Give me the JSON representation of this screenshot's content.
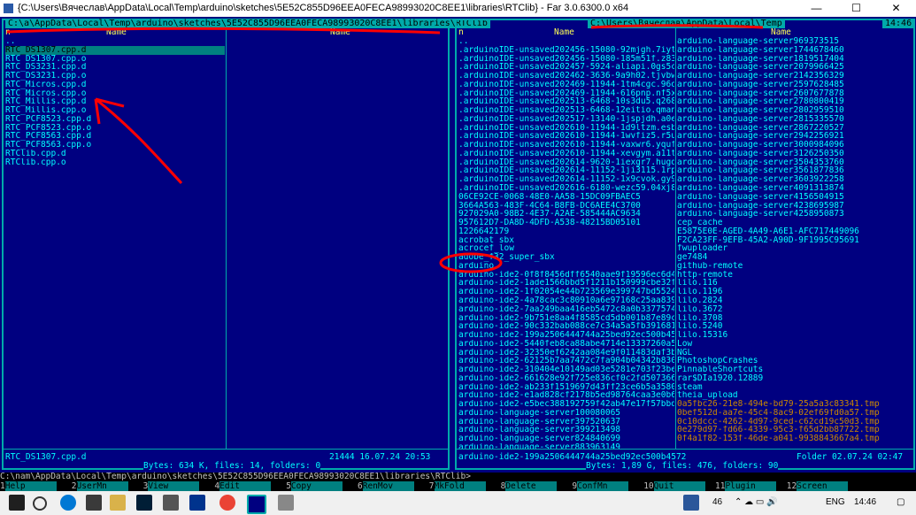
{
  "window": {
    "title": "{C:\\Users\\Вячеслав\\AppData\\Local\\Temp\\arduino\\sketches\\5E52C855D96EEA0FECA98993020C8EE1\\libraries\\RTClib} - Far 3.0.6300.0 x64",
    "min": "—",
    "max": "☐",
    "close": "✕"
  },
  "clock": "14:46",
  "left_panel": {
    "path": " C:\\a\\AppData\\Local\\Temp\\arduino\\sketches\\5E52C855D96EEA0FECA98993020C8EE1\\libraries\\RTClib ",
    "col1_header": "Name",
    "col2_header": "Name",
    "sort": "n",
    "files": [
      "..",
      "RTC_DS1307.cpp.d",
      "RTC_DS1307.cpp.o",
      "RTC_DS3231.cpp.d",
      "RTC_DS3231.cpp.o",
      "RTC_Micros.cpp.d",
      "RTC_Micros.cpp.o",
      "RTC_Millis.cpp.d",
      "RTC_Millis.cpp.o",
      "RTC_PCF8523.cpp.d",
      "RTC_PCF8523.cpp.o",
      "RTC_PCF8563.cpp.d",
      "RTC_PCF8563.cpp.o",
      "RTClib.cpp.d",
      "RTClib.cpp.o"
    ],
    "current_file": "RTC_DS1307.cpp.d",
    "file_info": "21444 16.07.24 20:53",
    "summary": " Bytes: 634 K, files: 14, folders: 0 "
  },
  "right_panel": {
    "path": " C:\\Users\\Вячеслав\\AppData\\Local\\Temp ",
    "col1_header": "Name",
    "col2_header": "Name",
    "sort": "n",
    "col1": [
      "..",
      ".arduinoIDE-unsaved202456-15080-92mjgh.7iytp",
      ".arduinoIDE-unsaved202456-15080-185m51f.z83d",
      ".arduinoIDE-unsaved202457-5924-aliapi.0gs5c",
      ".arduinoIDE-unsaved202462-3636-9a9h02.tjvbw",
      ".arduinoIDE-unsaved202469-11944-1tm4cgc.96oi",
      ".arduinoIDE-unsaved202469-11944-616pnp.nf5xa",
      ".arduinoIDE-unsaved202513-6468-10s3du5.q268",
      ".arduinoIDE-unsaved202513-6468-12eitio.qman",
      ".arduinoIDE-unsaved202517-13140-1jspjdh.a0es",
      ".arduinoIDE-unsaved202610-11944-1d9ltzm.esbj",
      ".arduinoIDE-unsaved202610-11944-1wvfiz5.r5ui",
      ".arduinoIDE-unsaved202610-11944-vaxwr6.yqufl",
      ".arduinoIDE-unsaved202610-11944-xevgym.a11t",
      ".arduinoIDE-unsaved202614-9620-1iexgr7.hugd",
      ".arduinoIDE-unsaved202614-11152-1ji3115.1rph",
      ".arduinoIDE-unsaved202614-11152-1x9cvok.gy92",
      ".arduinoIDE-unsaved202616-6180-wezc59.04xj8",
      "06CE92CE-0068-48E0-AA58-15DC09FBAEC5",
      "3664A563-483F-4C64-B8FB-DC6AEE4C3700",
      "927029A0-98B2-4E37-A2AE-585444AC9634",
      "957612D7-DA8D-4DFD-A538-48215BD05101",
      "1226642179",
      "acrobat_sbx",
      "acrocef_low",
      "adobe_f32_super_sbx",
      "arduino",
      "arduino-ide2-0f8f8456dff6540aae9f19596ec6d42b",
      "arduino-ide2-1ade1566bbd5f1211b150999cbe32f09",
      "arduino-ide2-1f02054e44b723569e399747bd5524",
      "arduino-ide2-4a78cac3c80910a6e97168c25aa83975",
      "arduino-ide2-7aa249baa416eb5472c8a0b3377574df",
      "arduino-ide2-9b751e8aa4f8585cd5db001b87e89c7f",
      "arduino-ide2-90c332bab088ce7c34a5a5fb3916819b",
      "arduino-ide2-199a2506444744a25bed92ec500b4572",
      "arduino-ide2-5440feb8ca88abe4714e13337260a5c3",
      "arduino-ide2-32350ef6242aa084e9f011483daf3bcf",
      "arduino-ide2-62125b7aa7472c7fa904b04342b83085",
      "arduino-ide2-310404e10149ad03e5281e703f23be5e",
      "arduino-ide2-661628e92f725e836cf0c2fd50736629",
      "arduino-ide2-ab233f1519697d43ff23ce6b5a3580d98",
      "arduino-ide2-e1ad828cf2178b5ed98764caa3e0b684a",
      "arduino-ide2-e5bec388192759f42ab47e17f57bbdee",
      "arduino-language-server100080065",
      "arduino-language-server397520637",
      "arduino-language-server399213498",
      "arduino-language-server824840699",
      "arduino-language-server883963149"
    ],
    "col2": [
      "arduino-language-server969373515",
      "arduino-language-server1744678460",
      "arduino-language-server1819517404",
      "arduino-language-server2079966425",
      "arduino-language-server2142356329",
      "arduino-language-server2597628485",
      "arduino-language-server2607677878",
      "arduino-language-server2780800419",
      "arduino-language-server2802959510",
      "arduino-language-server2815335570",
      "arduino-language-server2867220527",
      "arduino-language-server2942256921",
      "arduino-language-server3000984096",
      "arduino-language-server3126250350",
      "arduino-language-server3504353760",
      "arduino-language-server3561877836",
      "arduino-language-server3603922258",
      "arduino-language-server4091313874",
      "arduino-language-server4156504915",
      "arduino-language-server4238695987",
      "arduino-language-server4258950873",
      "cep_cache",
      "E5875E0E-AGED-4A49-A6E1-AFC717449096",
      "F2CA23FF-9EFB-45A2-A90D-9F1995C95691",
      "fwuploader",
      "ge7484",
      "github-remote",
      "http-remote",
      "lilo.116",
      "lilo.1196",
      "lilo.2824",
      "lilo.3672",
      "lilo.3708",
      "lilo.5240",
      "lilo.15316",
      "Low",
      "NGL",
      "PhotoshopCrashes",
      "PinnableShortcuts",
      "rar$DIa1920.12889",
      "steam",
      "theia_upload",
      "0a5fbc26-21e8-494e-bd79-25a5a3c83341.tmp",
      "0bef512d-aa7e-45c4-8ac9-02ef69fd0a57.tmp",
      "0c10dccc-4262-4d97-9ced-c62cd19c50d3.tmp",
      "0e279d97-fd66-4339-95c3-f65d2bb87722.tmp",
      "0f4a1f82-153f-46de-a041-9938843667a4.tmp"
    ],
    "tmp_count": 5,
    "current_file": "arduino-ide2-199a2506444744a25bed92ec500b4572",
    "file_info": "Folder 02.07.24 02:47",
    "summary": " Bytes: 1,89 G, files: 476, folders: 90 "
  },
  "command_line": "C:\\nam\\AppData\\Local\\Temp\\arduino\\sketches\\5E52C855D96EEA0FECA98993020C8EE1\\libraries\\RTClib>",
  "keybar": [
    {
      "n": "1",
      "label": "Help"
    },
    {
      "n": "2",
      "label": "UserMn"
    },
    {
      "n": "3",
      "label": "View"
    },
    {
      "n": "4",
      "label": "Edit"
    },
    {
      "n": "5",
      "label": "Copy"
    },
    {
      "n": "6",
      "label": "RenMov"
    },
    {
      "n": "7",
      "label": "MkFold"
    },
    {
      "n": "8",
      "label": "Delete"
    },
    {
      "n": "9",
      "label": "ConfMn"
    },
    {
      "n": "10",
      "label": "Quit"
    },
    {
      "n": "11",
      "label": "Plugin"
    },
    {
      "n": "12",
      "label": "Screen"
    }
  ],
  "taskbar": {
    "temp": "46",
    "lang": "ENG",
    "time": "14:46",
    "colors": {
      "ps": "#001e36",
      "chrome": "#ea4335",
      "word": "#2b579a",
      "far": "#000080"
    }
  },
  "colors": {
    "panel_bg": "#000080",
    "border": "#00aaaa",
    "file": "#00ffff",
    "header": "#ffff55",
    "annotation": "#ff0000"
  }
}
